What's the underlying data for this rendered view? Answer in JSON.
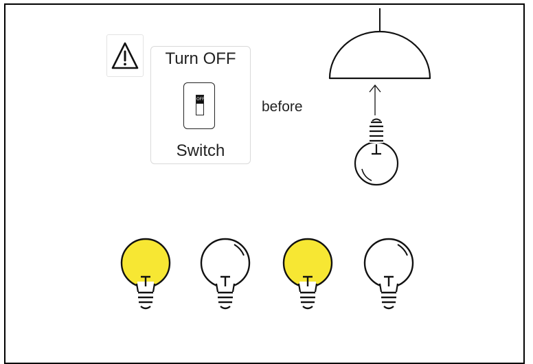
{
  "warning": {
    "icon": "warning-triangle-icon"
  },
  "switch_card": {
    "top_text": "Turn OFF",
    "switch_label": "OFF",
    "bottom_text": "Switch"
  },
  "connector_text": "before",
  "lamp": {
    "icons": [
      "ceiling-lamp-shade-icon",
      "up-arrow-icon",
      "light-bulb-icon"
    ]
  },
  "bulbs": [
    {
      "lit": true,
      "color": "#f7e733"
    },
    {
      "lit": false,
      "color": "#ffffff"
    },
    {
      "lit": true,
      "color": "#f7e733"
    },
    {
      "lit": false,
      "color": "#ffffff"
    }
  ]
}
